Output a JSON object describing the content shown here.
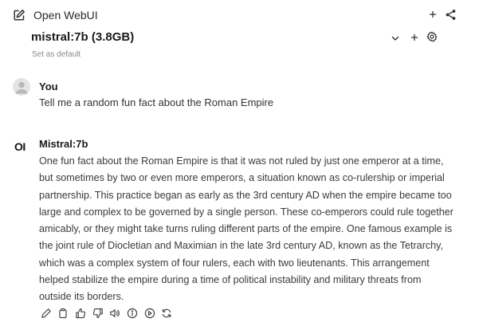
{
  "app": {
    "title": "Open WebUI"
  },
  "model": {
    "name": "mistral:7b (3.8GB)",
    "set_default_label": "Set as default"
  },
  "messages": [
    {
      "role": "user",
      "author": "You",
      "text": "Tell me a random fun fact about the Roman Empire"
    },
    {
      "role": "assistant",
      "author": "Mistral:7b",
      "logo": "OI",
      "text": "One fun fact about the Roman Empire is that it was not ruled by just one emperor at a time, but sometimes by two or even more emperors, a situation known as co-rulership or imperial partnership. This practice began as early as the 3rd century AD when the empire became too large and complex to be governed by a single person. These co-emperors could rule together amicably, or they might take turns ruling different parts of the empire. One famous example is the joint rule of Diocletian and Maximian in the late 3rd century AD, known as the Tetrarchy, which was a complex system of four rulers, each with two lieutenants. This arrangement helped stabilize the empire during a time of political instability and military threats from outside its borders."
    }
  ],
  "icons": {
    "top_bar": [
      "new-chat-icon",
      "plus-icon",
      "share-icon"
    ],
    "model_row": [
      "chevron-down-icon",
      "plus-icon",
      "gear-icon"
    ],
    "message_actions": [
      "edit-icon",
      "copy-icon",
      "thumbs-up-icon",
      "thumbs-down-icon",
      "speaker-icon",
      "info-icon",
      "continue-icon",
      "regenerate-icon"
    ]
  }
}
